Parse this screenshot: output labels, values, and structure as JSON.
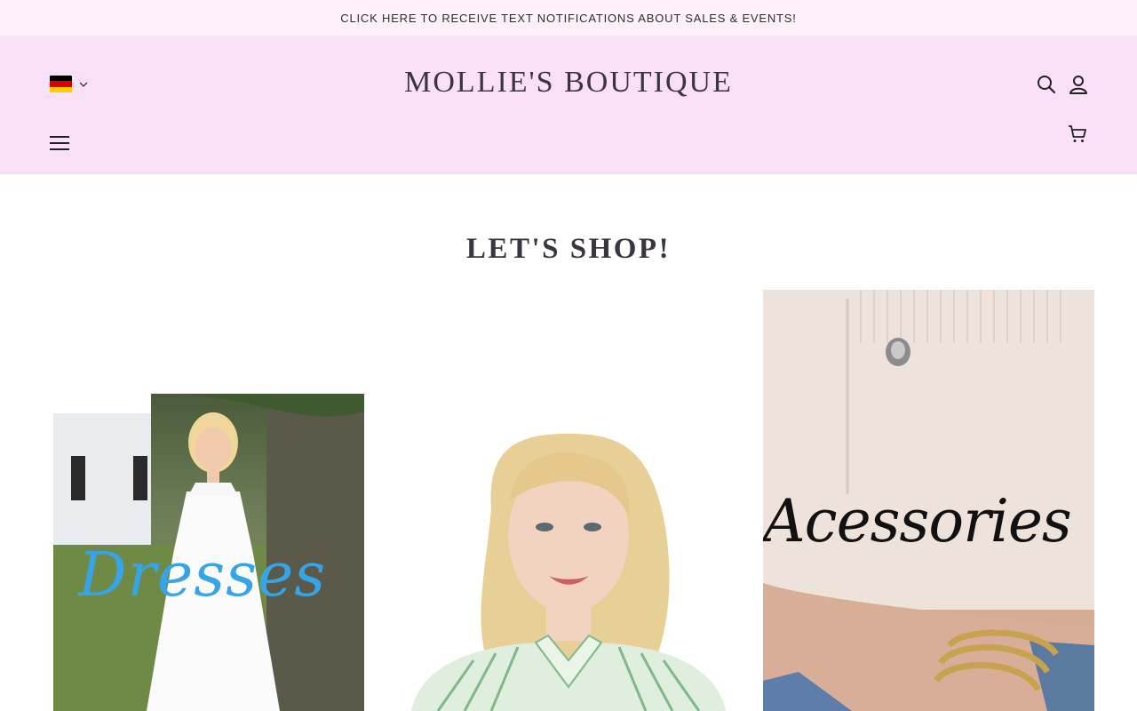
{
  "announcement": {
    "text": "CLICK HERE TO RECEIVE TEXT NOTIFICATIONS ABOUT SALES & EVENTS!"
  },
  "header": {
    "logo": "MOLLIE'S BOUTIQUE",
    "language": {
      "icon": "germany-flag-icon",
      "dropdown_icon": "chevron-down-icon"
    },
    "icons": [
      "search-icon",
      "account-icon",
      "cart-icon",
      "menu-icon"
    ]
  },
  "section": {
    "title": "LET'S SHOP!"
  },
  "collections": [
    {
      "label": "Dresses",
      "label_color": "#36a4e6"
    },
    {
      "label": ""
    },
    {
      "label": "Acessories",
      "label_color": "#111111"
    }
  ],
  "colors": {
    "announcement_bg": "#fdf0fa",
    "header_bg": "#fae0f7",
    "text": "#3b3540"
  }
}
